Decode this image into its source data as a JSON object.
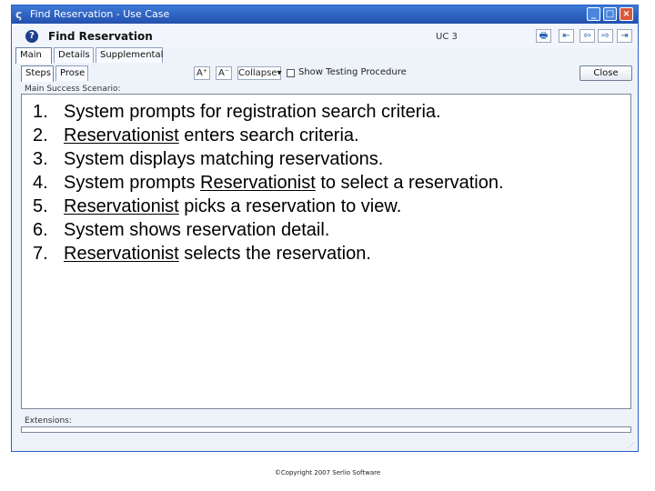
{
  "window": {
    "title": "Find Reservation - Use Case",
    "controls": {
      "minimize": "_",
      "maximize": "□",
      "close": "×"
    }
  },
  "header": {
    "title": "Find Reservation",
    "help_icon": "?",
    "id": "UC 3",
    "nav_buttons": [
      {
        "name": "print-icon",
        "glyph": "🖶"
      },
      {
        "name": "first-icon",
        "glyph": "⇤"
      },
      {
        "name": "back-icon",
        "glyph": "⇦"
      },
      {
        "name": "forward-icon",
        "glyph": "⇨"
      },
      {
        "name": "last-icon",
        "glyph": "⇥"
      }
    ]
  },
  "tabs": [
    "Main",
    "Details",
    "Supplemental"
  ],
  "subtabs": [
    "Steps",
    "Prose"
  ],
  "toolbar": {
    "font_increase": "A⁺",
    "font_decrease": "A⁻",
    "collapse_label": "Collapse▾",
    "show_testing_label": "Show Testing Procedure",
    "show_testing_checked": false,
    "close_label": "Close"
  },
  "scenario": {
    "label": "Main Success Scenario:",
    "steps": [
      {
        "num": "1.",
        "actor": "",
        "text": "System prompts for registration search criteria."
      },
      {
        "num": "2.",
        "actor": "Reservationist",
        "text": " enters search criteria."
      },
      {
        "num": "3.",
        "actor": "",
        "text": "System displays matching reservations."
      },
      {
        "num": "4.",
        "pre": "System prompts ",
        "actor": "Reservationist",
        "text": " to select a reservation."
      },
      {
        "num": "5.",
        "actor": "Reservationist",
        "text": " picks a reservation to view."
      },
      {
        "num": "6.",
        "actor": "",
        "text": "System shows reservation detail."
      },
      {
        "num": "7.",
        "actor": "Reservationist",
        "text": " selects the reservation."
      }
    ]
  },
  "extensions_label": "Extensions:",
  "footer": {
    "copyright": "©Copyright 2007 Serlio Software"
  },
  "colors": {
    "titlebar": "#2d63c0",
    "accent": "#1a5cb0"
  }
}
